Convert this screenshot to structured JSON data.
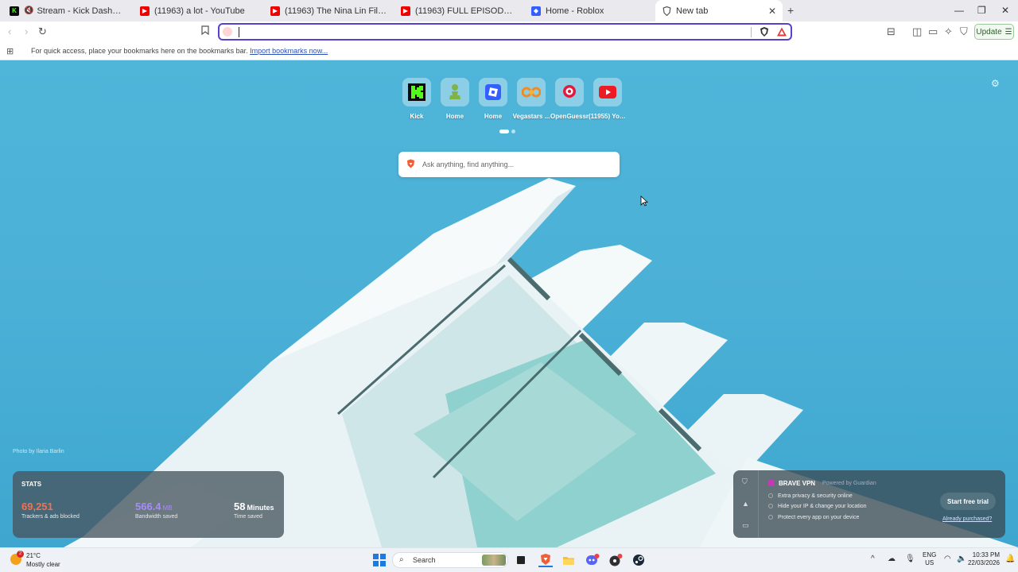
{
  "tabs": [
    {
      "title": "Stream - Kick Dashboard",
      "favicon": "kick-icon",
      "muted": true
    },
    {
      "title": "(11963) a lot - YouTube",
      "favicon": "youtube-icon"
    },
    {
      "title": "(11963) The Nina Lin Files - YouTube",
      "favicon": "youtube-icon"
    },
    {
      "title": "(11963) FULL EPISODE: Rey de Reyes",
      "favicon": "youtube-icon"
    },
    {
      "title": "Home - Roblox",
      "favicon": "roblox-icon"
    },
    {
      "title": "New tab",
      "favicon": "brave-icon",
      "active": true
    }
  ],
  "toolbar": {
    "address_value": "",
    "update_label": "Update"
  },
  "bookmarks_bar": {
    "message": "For quick access, place your bookmarks here on the bookmarks bar.",
    "import_link": "Import bookmarks now..."
  },
  "top_sites": [
    {
      "label": "Kick",
      "icon": "kick-icon"
    },
    {
      "label": "Home",
      "icon": "chess-pawn-icon"
    },
    {
      "label": "Home",
      "icon": "roblox-icon"
    },
    {
      "label": "Vegastars ...",
      "icon": "vegastars-icon"
    },
    {
      "label": "OpenGuessr",
      "icon": "location-pin-icon"
    },
    {
      "label": "(11955) You...",
      "icon": "youtube-icon"
    }
  ],
  "search": {
    "placeholder": "Ask anything, find anything..."
  },
  "photo_credit": "Photo by Ilaria Barlin",
  "stats": {
    "title": "STATS",
    "trackers_value": "69,251",
    "trackers_label": "Trackers & ads blocked",
    "bandwidth_value": "566.4",
    "bandwidth_unit": "MB",
    "bandwidth_label": "Bandwidth saved",
    "time_value": "58",
    "time_unit": "Minutes",
    "time_label": "Time saved",
    "colors": {
      "trackers": "#f4714f",
      "bandwidth": "#a78bfa",
      "time": "#ffffff"
    }
  },
  "vpn": {
    "title": "BRAVE VPN",
    "powered_by": "Powered by Guardian",
    "features": [
      "Extra privacy & security online",
      "Hide your IP & change your location",
      "Protect every app on your device"
    ],
    "cta": "Start free trial",
    "already_purchased": "Already purchased?"
  },
  "taskbar": {
    "weather_temp": "21°C",
    "weather_cond": "Mostly clear",
    "weather_badge": "2",
    "search_label": "Search",
    "lang_line1": "ENG",
    "lang_line2": "US",
    "time": "10:33 PM",
    "date": "22/03/2026"
  }
}
